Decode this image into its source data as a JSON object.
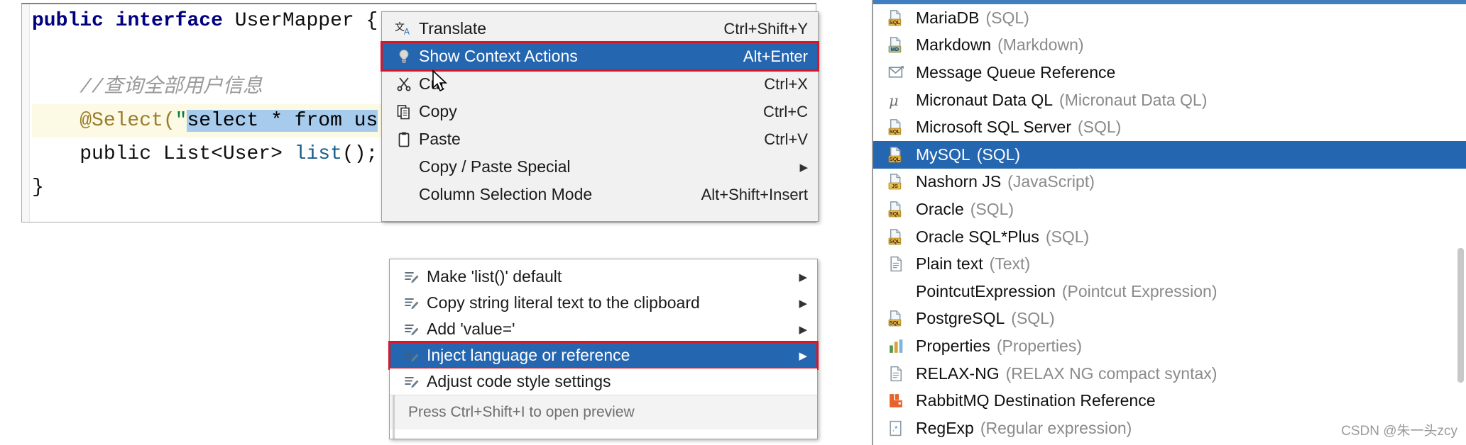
{
  "editor": {
    "lines": [
      {
        "tokens": [
          {
            "t": "public",
            "c": "kw"
          },
          {
            "t": " ",
            "c": "plain"
          },
          {
            "t": "interface",
            "c": "kw"
          },
          {
            "t": " ",
            "c": "plain"
          },
          {
            "t": "UserMapper",
            "c": "type"
          },
          {
            "t": " {",
            "c": "punct"
          }
        ]
      },
      {
        "tokens": []
      },
      {
        "tokens": [
          {
            "t": "    //查询全部用户信息",
            "c": "cmt"
          }
        ]
      },
      {
        "tokens": [
          {
            "t": "    ",
            "c": "plain"
          },
          {
            "t": "@Select(",
            "c": "ann"
          },
          {
            "t": "\"",
            "c": "str"
          },
          {
            "t": "select * from us",
            "c": "sel"
          }
        ]
      },
      {
        "tokens": [
          {
            "t": "    ",
            "c": "plain"
          },
          {
            "t": "public",
            "c": "plain"
          },
          {
            "t": " ",
            "c": "plain"
          },
          {
            "t": "List<User>",
            "c": "type"
          },
          {
            "t": " ",
            "c": "plain"
          },
          {
            "t": "list",
            "c": "mth"
          },
          {
            "t": "();",
            "c": "punct"
          }
        ]
      },
      {
        "tokens": [
          {
            "t": "}",
            "c": "punct"
          }
        ]
      }
    ],
    "raw_text": "public interface UserMapper {\n\n    //查询全部用户信息\n    @Select(\"select * from us\n    public List<User> list();\n}"
  },
  "context_menu": {
    "items": [
      {
        "label": "Translate",
        "shortcut": "Ctrl+Shift+Y",
        "icon": "translate-icon",
        "selected": false,
        "submenu": false
      },
      {
        "label": "Show Context Actions",
        "shortcut": "Alt+Enter",
        "icon": "lightbulb-icon",
        "selected": true,
        "submenu": false
      },
      {
        "label": "Cut",
        "shortcut": "Ctrl+X",
        "icon": "scissors-icon",
        "selected": false,
        "submenu": false
      },
      {
        "label": "Copy",
        "shortcut": "Ctrl+C",
        "icon": "copy-icon",
        "selected": false,
        "submenu": false
      },
      {
        "label": "Paste",
        "shortcut": "Ctrl+V",
        "icon": "clipboard-icon",
        "selected": false,
        "submenu": false
      },
      {
        "label": "Copy / Paste Special",
        "shortcut": "",
        "icon": "none",
        "selected": false,
        "submenu": true
      },
      {
        "label": "Column Selection Mode",
        "shortcut": "Alt+Shift+Insert",
        "icon": "none",
        "selected": false,
        "submenu": false
      }
    ]
  },
  "intentions_menu": {
    "items": [
      {
        "label": "Make 'list()' default",
        "icon": "intention-icon",
        "selected": false,
        "submenu": true
      },
      {
        "label": "Copy string literal text to the clipboard",
        "icon": "intention-icon",
        "selected": false,
        "submenu": true
      },
      {
        "label": "Add 'value='",
        "icon": "intention-icon",
        "selected": false,
        "submenu": true
      },
      {
        "label": "Inject language or reference",
        "icon": "intention-icon",
        "selected": true,
        "submenu": true
      },
      {
        "label": "Adjust code style settings",
        "icon": "intention-icon",
        "selected": false,
        "submenu": false
      }
    ],
    "footer": "Press Ctrl+Shift+I to open preview"
  },
  "language_list": {
    "items": [
      {
        "name": "MariaDB",
        "paren": "(SQL)",
        "icon": "sql-file-icon",
        "badge": "SQL",
        "badge_color": "#e8b54d",
        "selected": false
      },
      {
        "name": "Markdown",
        "paren": "(Markdown)",
        "icon": "markdown-file-icon",
        "badge": "MD",
        "badge_color": "#7fc4e8",
        "selected": false
      },
      {
        "name": "Message Queue Reference",
        "paren": "",
        "icon": "message-queue-icon",
        "badge": "",
        "badge_color": "",
        "selected": false
      },
      {
        "name": "Micronaut Data QL",
        "paren": "(Micronaut Data QL)",
        "icon": "micronaut-mu-icon",
        "badge": "",
        "badge_color": "",
        "selected": false
      },
      {
        "name": "Microsoft SQL Server",
        "paren": "(SQL)",
        "icon": "sql-file-icon",
        "badge": "SQL",
        "badge_color": "#e8b54d",
        "selected": false
      },
      {
        "name": "MySQL",
        "paren": "(SQL)",
        "icon": "sql-file-icon",
        "badge": "SQL",
        "badge_color": "#e8b54d",
        "selected": true
      },
      {
        "name": "Nashorn JS",
        "paren": "(JavaScript)",
        "icon": "js-file-icon",
        "badge": "JS",
        "badge_color": "#e8c24d",
        "selected": false
      },
      {
        "name": "Oracle",
        "paren": "(SQL)",
        "icon": "sql-file-icon",
        "badge": "SQL",
        "badge_color": "#e8b54d",
        "selected": false
      },
      {
        "name": "Oracle SQL*Plus",
        "paren": "(SQL)",
        "icon": "sql-file-icon",
        "badge": "SQL",
        "badge_color": "#e8b54d",
        "selected": false
      },
      {
        "name": "Plain text",
        "paren": "(Text)",
        "icon": "text-file-icon",
        "badge": "",
        "badge_color": "",
        "selected": false
      },
      {
        "name": "PointcutExpression",
        "paren": "(Pointcut Expression)",
        "icon": "none",
        "badge": "",
        "badge_color": "",
        "selected": false
      },
      {
        "name": "PostgreSQL",
        "paren": "(SQL)",
        "icon": "sql-file-icon",
        "badge": "SQL",
        "badge_color": "#e8b54d",
        "selected": false
      },
      {
        "name": "Properties",
        "paren": "(Properties)",
        "icon": "properties-icon",
        "badge": "",
        "badge_color": "",
        "selected": false
      },
      {
        "name": "RELAX-NG",
        "paren": "(RELAX NG compact syntax)",
        "icon": "text-file-icon",
        "badge": "",
        "badge_color": "",
        "selected": false
      },
      {
        "name": "RabbitMQ Destination Reference",
        "paren": "",
        "icon": "rabbitmq-icon",
        "badge": "",
        "badge_color": "",
        "selected": false
      },
      {
        "name": "RegExp",
        "paren": "(Regular expression)",
        "icon": "regexp-icon",
        "badge": "",
        "badge_color": "",
        "selected": false
      }
    ]
  },
  "watermark": "CSDN @朱一头zcy",
  "colors": {
    "selection_blue": "#2566b0",
    "highlight_red": "#d8162a",
    "menu_bg": "#f1f1f1",
    "code_selection": "#a6cbec",
    "caret_line": "#fcf9e4",
    "paren_gray": "#8a8a8a"
  }
}
